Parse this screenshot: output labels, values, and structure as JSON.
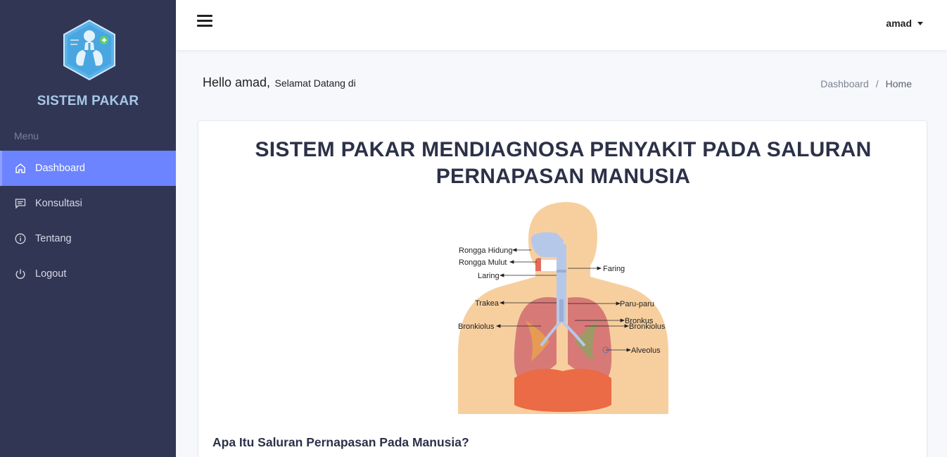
{
  "app": {
    "brand": "SISTEM PAKAR",
    "menu_heading": "Menu",
    "accent_color": "#6c84ff",
    "sidebar_color": "#313654"
  },
  "sidebar": {
    "items": [
      {
        "label": "Dashboard",
        "icon": "home-icon",
        "active": true
      },
      {
        "label": "Konsultasi",
        "icon": "chat-icon",
        "active": false
      },
      {
        "label": "Tentang",
        "icon": "info-icon",
        "active": false
      },
      {
        "label": "Logout",
        "icon": "power-icon",
        "active": false
      }
    ]
  },
  "topbar": {
    "username": "amad"
  },
  "greeting": {
    "hello": "Hello amad,",
    "welcome": "Selamat Datang di"
  },
  "breadcrumb": {
    "items": [
      "Dashboard",
      "Home"
    ],
    "separator": "/"
  },
  "card": {
    "title": "SISTEM PAKAR MENDIAGNOSA PENYAKIT PADA SALURAN PERNAPASAN MANUSIA",
    "section_heading": "Apa Itu Saluran Pernapasan Pada Manusia?"
  },
  "figure": {
    "labels": {
      "rongga_hidung": "Rongga Hidung",
      "rongga_mulut": "Rongga Mulut",
      "laring": "Laring",
      "trakea": "Trakea",
      "bronkiolus_left": "Bronkiolus",
      "faring": "Faring",
      "paru_paru": "Paru-paru",
      "bronkus": "Bronkus",
      "bronkiolus_right": "Bronkiolus",
      "alveolus": "Alveolus"
    }
  }
}
